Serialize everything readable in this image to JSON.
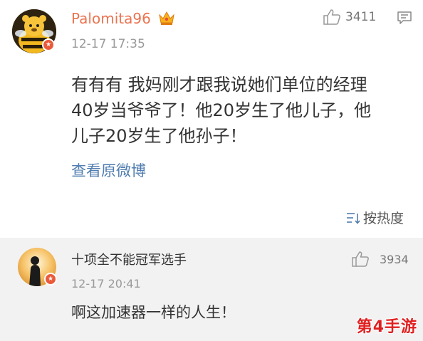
{
  "post": {
    "username": "Palomita96",
    "timestamp": "12-17 17:35",
    "like_count": "3411",
    "body_lines": [
      "有有有  我妈刚才跟我说她们单位的经理",
      "40岁当爷爷了！他20岁生了他儿子，他",
      "儿子20岁生了他孙子！"
    ],
    "view_original": "查看原微博",
    "sort_label": "按热度",
    "icons": {
      "avatar": "bee-avatar",
      "badge": "orange-star-badge",
      "vip": "crown-icon",
      "like": "thumbs-up-icon",
      "menu": "chat-bubble-menu-icon",
      "sort": "sort-lines-icon"
    }
  },
  "reply": {
    "username": "十项全不能冠军选手",
    "timestamp": "12-17 20:41",
    "like_count": "3934",
    "body": "啊这加速器一样的人生！"
  },
  "watermark": "第4手游",
  "colors": {
    "username_accent": "#eb7350",
    "link": "#507daf",
    "reply_bg": "#f2f2f2",
    "badge": "#ea5a3a",
    "watermark": "#e02020"
  }
}
